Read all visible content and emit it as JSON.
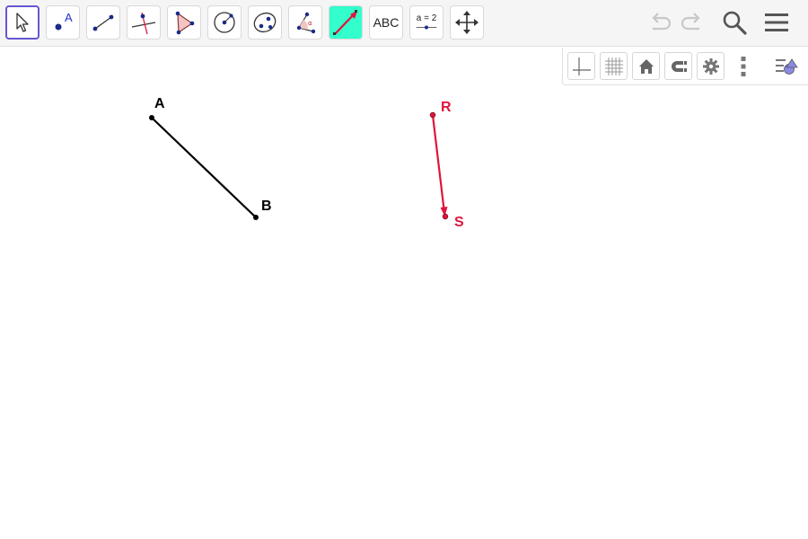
{
  "toolbar": {
    "tools": [
      {
        "name": "move-tool",
        "icon": "cursor-arrow-icon",
        "active": true
      },
      {
        "name": "point-tool",
        "icon": "point-icon",
        "point_label": "A"
      },
      {
        "name": "segment-tool",
        "icon": "segment-icon"
      },
      {
        "name": "perpendicular-line-tool",
        "icon": "perpendicular-line-icon"
      },
      {
        "name": "polygon-tool",
        "icon": "polygon-icon"
      },
      {
        "name": "circle-tool",
        "icon": "circle-center-point-icon"
      },
      {
        "name": "conic-tool",
        "icon": "ellipse-icon"
      },
      {
        "name": "angle-tool",
        "icon": "angle-icon",
        "angle_symbol": "α"
      },
      {
        "name": "translate-by-vector-tool",
        "icon": "translate-vector-icon"
      },
      {
        "name": "text-tool",
        "icon": "text-icon",
        "label": "ABC"
      },
      {
        "name": "slider-tool",
        "icon": "slider-icon",
        "label": "a = 2"
      },
      {
        "name": "move-graphics-view-tool",
        "icon": "move-view-icon"
      }
    ],
    "right": {
      "undo": "undo-icon",
      "redo": "redo-icon",
      "search": "search-icon",
      "menu": "hamburger-menu-icon"
    }
  },
  "style_bar": {
    "buttons": [
      "axes-icon",
      "grid-icon",
      "home-icon",
      "point-capturing-icon",
      "settings-gear-icon",
      "more-vert-icon",
      "style-bar-toggle-icon"
    ]
  },
  "graphics": {
    "segment": {
      "label_start": "A",
      "label_end": "B",
      "color": "#000000"
    },
    "vector": {
      "label_start": "R",
      "label_end": "S",
      "color": "#e0143c"
    }
  },
  "colors": {
    "accent": "#6557d2",
    "vector_red": "#e0143c",
    "vector_tool_bg": "#33ffcc"
  }
}
